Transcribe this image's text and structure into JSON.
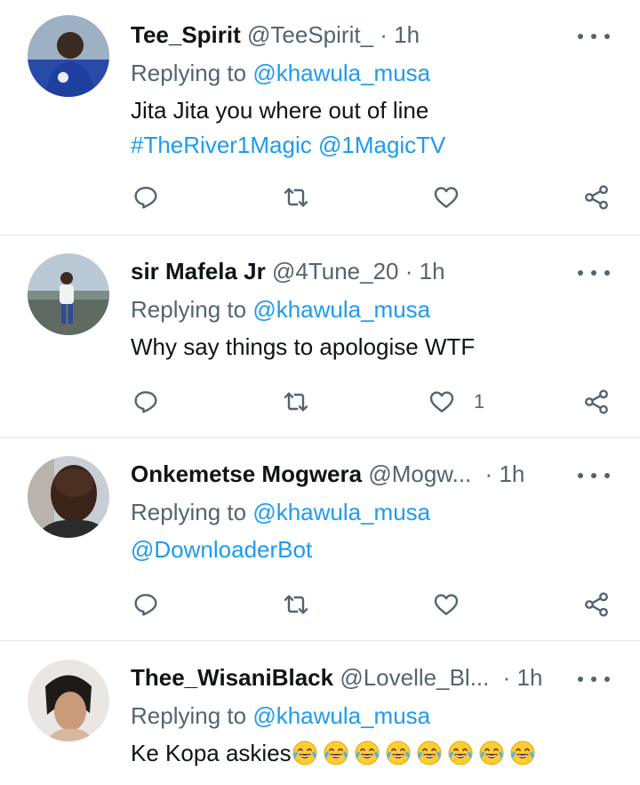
{
  "tweets": [
    {
      "name": "Tee_Spirit",
      "handle": "@TeeSpirit_",
      "dot": "·",
      "time": "1h",
      "reply_prefix": "Replying to",
      "reply_to": "@khawula_musa",
      "text": "Jita Jita you where out of line",
      "links": "#TheRiver1Magic @1MagicTV",
      "like_count": ""
    },
    {
      "name": "sir Mafela Jr",
      "handle": "@4Tune_20",
      "dot": "·",
      "time": "1h",
      "reply_prefix": "Replying to",
      "reply_to": "@khawula_musa",
      "text": "Why say things to apologise WTF",
      "like_count": "1"
    },
    {
      "name": "Onkemetse Mogwera",
      "handle": "@Mogw...",
      "dot": "·",
      "time": "1h",
      "reply_prefix": "Replying to",
      "reply_to": "@khawula_musa",
      "text_link": "@DownloaderBot",
      "like_count": ""
    },
    {
      "name": "Thee_WisaniBlack",
      "handle": "@Lovelle_Bl...",
      "dot": "·",
      "time": "1h",
      "reply_prefix": "Replying to",
      "reply_to": "@khawula_musa",
      "text": "Ke Kopa askies",
      "emoji": "face-with-tears-of-joy",
      "emoji_count": 8
    }
  ],
  "colors": {
    "link": "#1d9bf0",
    "secondary": "#536471",
    "divider": "#e3e7ea",
    "text": "#0f1419"
  }
}
